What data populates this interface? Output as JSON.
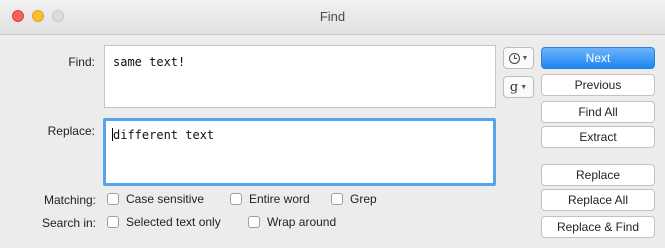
{
  "window": {
    "title": "Find"
  },
  "find": {
    "label": "Find:",
    "value": "same text!"
  },
  "replace": {
    "label": "Replace:",
    "value": "different text"
  },
  "history_menu": {
    "icon": "clock-icon"
  },
  "grep_menu": {
    "glyph": "g"
  },
  "buttons": {
    "next": "Next",
    "previous": "Previous",
    "find_all": "Find All",
    "extract": "Extract",
    "replace": "Replace",
    "replace_all": "Replace All",
    "replace_and_find": "Replace & Find"
  },
  "matching": {
    "label": "Matching:",
    "options": {
      "case_sensitive": "Case sensitive",
      "entire_word": "Entire word",
      "grep": "Grep"
    }
  },
  "search_in": {
    "label": "Search in:",
    "options": {
      "selected_text_only": "Selected text only",
      "wrap_around": "Wrap around"
    }
  },
  "colors": {
    "accent": "#1d86f4",
    "focus_ring": "#58a3f0"
  }
}
